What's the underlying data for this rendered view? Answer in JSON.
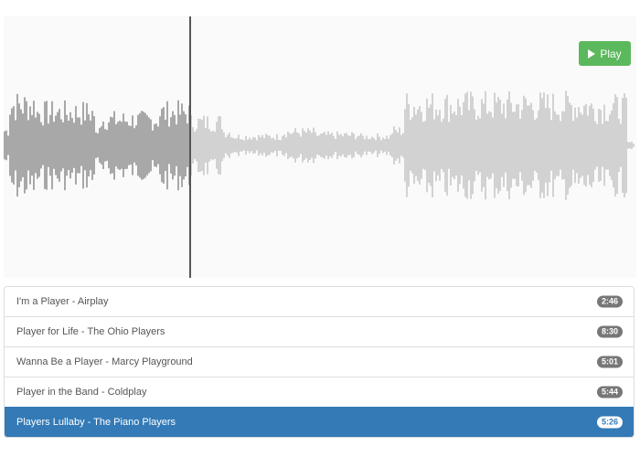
{
  "player": {
    "play_label": "Play",
    "progress": 0.295,
    "played_color": "#555555",
    "unplayed_color": "#aaaaaa",
    "cursor_color": "#555555",
    "play_button_color": "#5cb85c"
  },
  "playlist": {
    "active_color": "#337ab7",
    "tracks": [
      {
        "title": "I'm a Player - Airplay",
        "duration": "2:46",
        "active": false
      },
      {
        "title": "Player for Life - The Ohio Players",
        "duration": "8:30",
        "active": false
      },
      {
        "title": "Wanna Be a Player - Marcy Playground",
        "duration": "5:01",
        "active": false
      },
      {
        "title": "Player in the Band - Coldplay",
        "duration": "5:44",
        "active": false
      },
      {
        "title": "Players Lullaby - The Piano Players",
        "duration": "5:26",
        "active": true
      }
    ]
  }
}
